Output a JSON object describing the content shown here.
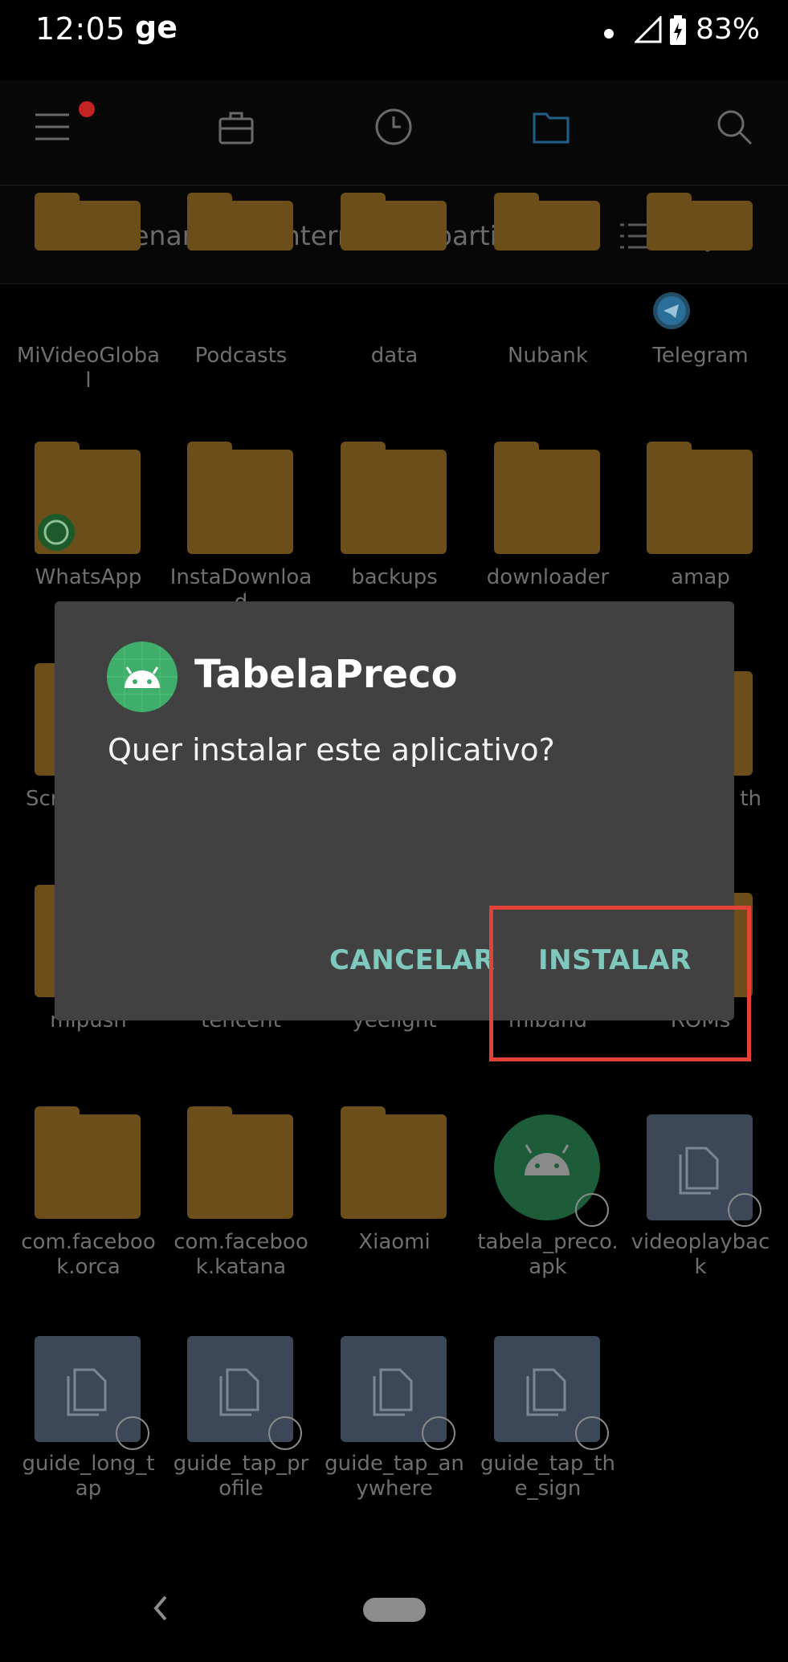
{
  "status_bar": {
    "time": "12:05",
    "carrier": "ge",
    "battery": "83%"
  },
  "path_bar": {
    "path": "Armazenamento interno compartilhado",
    "chevron": "›"
  },
  "folders": {
    "row1": [
      "MiVideoGlobal",
      "Podcasts",
      "data",
      "Nubank",
      "Telegram"
    ],
    "row2": [
      "WhatsApp",
      "InstaDownload",
      "backups",
      "downloader",
      "amap"
    ],
    "row3_partial": [
      "Scr",
      "th"
    ],
    "row4": [
      "mipush",
      "tencent",
      "yeelight",
      "miband",
      "ROMs"
    ],
    "row5": [
      "com.facebook.orca",
      "com.facebook.katana",
      "Xiaomi",
      "tabela_preco.apk",
      "videoplayback"
    ],
    "row6": [
      "guide_long_tap",
      "guide_tap_profile",
      "guide_tap_anywhere",
      "guide_tap_the_sign"
    ]
  },
  "dialog": {
    "app_name": "TabelaPreco",
    "question": "Quer instalar este aplicativo?",
    "cancel_label": "CANCELAR",
    "install_label": "INSTALAR"
  },
  "colors": {
    "accent": "#7fc8bd",
    "highlight": "#e34336",
    "folder": "#6c4e1a",
    "dialog_bg": "#414141"
  },
  "icons": [
    "menu-icon",
    "briefcase-icon",
    "clock-icon",
    "folder-icon",
    "search-icon",
    "list-view-icon",
    "more-icon",
    "android-icon",
    "whatsapp-icon",
    "telegram-icon",
    "back-icon"
  ]
}
